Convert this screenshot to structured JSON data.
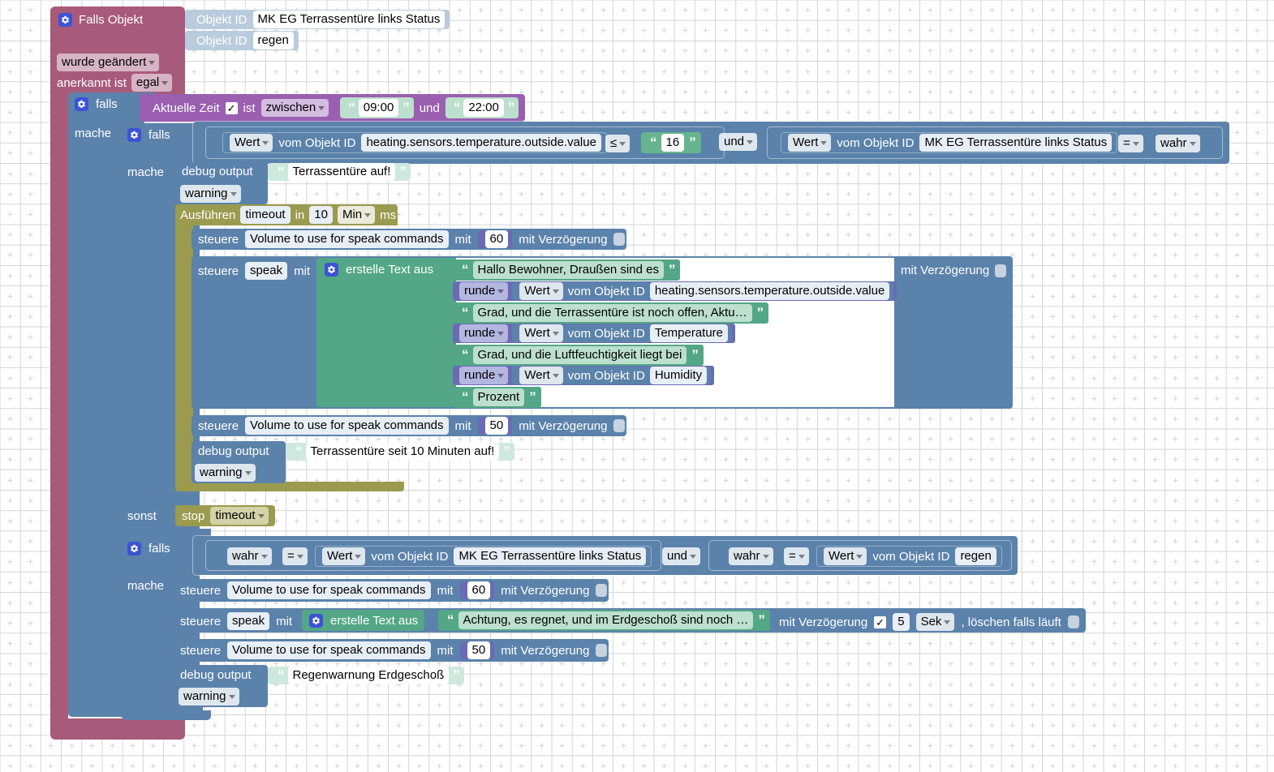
{
  "editor": {
    "name": "blockly-visual-script-editor",
    "language": "de",
    "colors": {
      "trigger": "#a85a7a",
      "control": "#5b82ab",
      "time": "#9a5fb0",
      "text": "#53a786",
      "text_light": "#cfe8dd",
      "timer": "#9a9b4e",
      "math": "#6a6bb5",
      "gear_icon": "#3b53d4",
      "background": "#ffffff"
    }
  },
  "trigger_block": {
    "gear_icon": "gear-icon",
    "title": "Falls Objekt",
    "object_rows": [
      {
        "label": "Objekt ID",
        "value": "MK EG Terrassentüre links Status"
      },
      {
        "label": "Objekt ID",
        "value": "regen"
      }
    ],
    "change_mode": "wurde geändert",
    "ack_label": "anerkannt ist",
    "ack_value": "egal"
  },
  "outer_if": {
    "gear_icon": "gear-icon",
    "if_label": "falls",
    "do_label": "mache",
    "condition": {
      "prefix": "Aktuelle Zeit",
      "checkbox": "✓",
      "is_label": "ist",
      "operator": "zwischen",
      "from": "09:00",
      "and_label": "und",
      "to": "22:00"
    }
  },
  "inner_if": {
    "gear_icon": "gear-icon",
    "if_label": "falls",
    "do_label": "mache",
    "else_label": "sonst",
    "condition": {
      "left": {
        "selector": "Wert",
        "middle": "vom Objekt ID",
        "object": "heating.sensors.temperature.outside.value"
      },
      "comparator": "≤",
      "compare_value": "16",
      "logic": "und",
      "right": {
        "selector": "Wert",
        "middle": "vom Objekt ID",
        "object": "MK EG Terrassentüre links Status",
        "comparator": "=",
        "value": "wahr"
      }
    },
    "body": {
      "debug": {
        "label": "debug output",
        "text": "Terrassentüre auf!",
        "level": "warning"
      },
      "timeout": {
        "run_label": "Ausführen",
        "name": "timeout",
        "in_label": "in",
        "amount": "10",
        "unit": "Min",
        "ms_label": "ms",
        "steps": [
          {
            "control_label": "steuere",
            "target": "Volume to use for speak commands",
            "with_label": "mit",
            "value": "60",
            "delay_label": "mit Verzögerung"
          },
          {
            "control_label": "steuere",
            "target": "speak",
            "with_label": "mit",
            "delay_label": "mit Verzögerung",
            "text_builder": {
              "gear_icon": "gear-icon",
              "title": "erstelle Text aus",
              "parts": [
                {
                  "type": "text",
                  "value": "Hallo Bewohner, Draußen sind es"
                },
                {
                  "type": "round",
                  "fn": "runde",
                  "selector": "Wert",
                  "middle": "vom Objekt ID",
                  "object": "heating.sensors.temperature.outside.value"
                },
                {
                  "type": "text",
                  "value": "Grad, und die Terrassentüre ist noch offen, Aktu…"
                },
                {
                  "type": "round",
                  "fn": "runde",
                  "selector": "Wert",
                  "middle": "vom Objekt ID",
                  "object": "Temperature"
                },
                {
                  "type": "text",
                  "value": "Grad, und die Luftfeuchtigkeit liegt bei"
                },
                {
                  "type": "round",
                  "fn": "runde",
                  "selector": "Wert",
                  "middle": "vom Objekt ID",
                  "object": "Humidity"
                },
                {
                  "type": "text",
                  "value": "Prozent"
                }
              ]
            }
          },
          {
            "control_label": "steuere",
            "target": "Volume to use for speak commands",
            "with_label": "mit",
            "value": "50",
            "delay_label": "mit Verzögerung"
          },
          {
            "control_label": "debug output",
            "text": "Terrassentüre seit 10 Minuten auf!",
            "level": "warning"
          }
        ]
      }
    },
    "else_body": {
      "stop_label": "stop",
      "timer_name": "timeout"
    }
  },
  "second_if": {
    "gear_icon": "gear-icon",
    "if_label": "falls",
    "do_label": "mache",
    "condition": {
      "left": {
        "bool": "wahr",
        "comparator": "=",
        "selector": "Wert",
        "middle": "vom Objekt ID",
        "object": "MK EG Terrassentüre links Status"
      },
      "logic": "und",
      "right": {
        "bool": "wahr",
        "comparator": "=",
        "selector": "Wert",
        "middle": "vom Objekt ID",
        "object": "regen"
      }
    },
    "body": [
      {
        "control_label": "steuere",
        "target": "Volume to use for speak commands",
        "with_label": "mit",
        "value": "60",
        "delay_label": "mit Verzögerung"
      },
      {
        "control_label": "steuere",
        "target": "speak",
        "with_label": "mit",
        "gear_icon": "gear-icon",
        "builder_title": "erstelle Text aus",
        "text": "Achtung, es regnet, und im Erdgeschoß sind noch …",
        "delay_label": "mit Verzögerung",
        "delay_checkbox": "✓",
        "delay_amount": "5",
        "delay_unit": "Sek",
        "clear_label": ", löschen falls läuft"
      },
      {
        "control_label": "steuere",
        "target": "Volume to use for speak commands",
        "with_label": "mit",
        "value": "50",
        "delay_label": "mit Verzögerung"
      },
      {
        "control_label": "debug output",
        "text": "Regenwarnung Erdgeschoß",
        "level": "warning"
      }
    ]
  }
}
